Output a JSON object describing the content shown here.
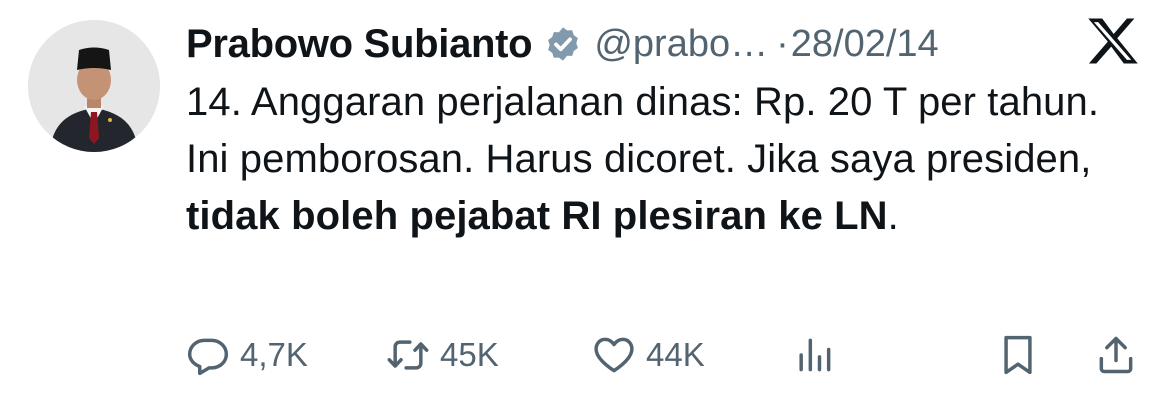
{
  "tweet": {
    "author_name": "Prabowo Subianto",
    "handle": "@prabo…",
    "separator": "·",
    "date": "28/02/14",
    "verified_icon": "verified-badge-icon",
    "platform_icon": "x-logo-icon",
    "text_plain": "14. Anggaran perjalanan dinas: Rp. 20 T per tahun. Ini pemborosan. Harus dicoret. Jika saya presiden, ",
    "text_bold": "tidak boleh pejabat RI plesiran ke LN",
    "text_end": "."
  },
  "actions": {
    "reply": {
      "icon": "reply-icon",
      "count": "4,7K"
    },
    "repost": {
      "icon": "repost-icon",
      "count": "45K"
    },
    "like": {
      "icon": "heart-icon",
      "count": "44K"
    },
    "views": {
      "icon": "analytics-icon"
    },
    "bookmark": {
      "icon": "bookmark-icon"
    },
    "share": {
      "icon": "share-icon"
    }
  },
  "colors": {
    "text": "#0f1419",
    "secondary": "#536471",
    "verified": "#829aab"
  }
}
